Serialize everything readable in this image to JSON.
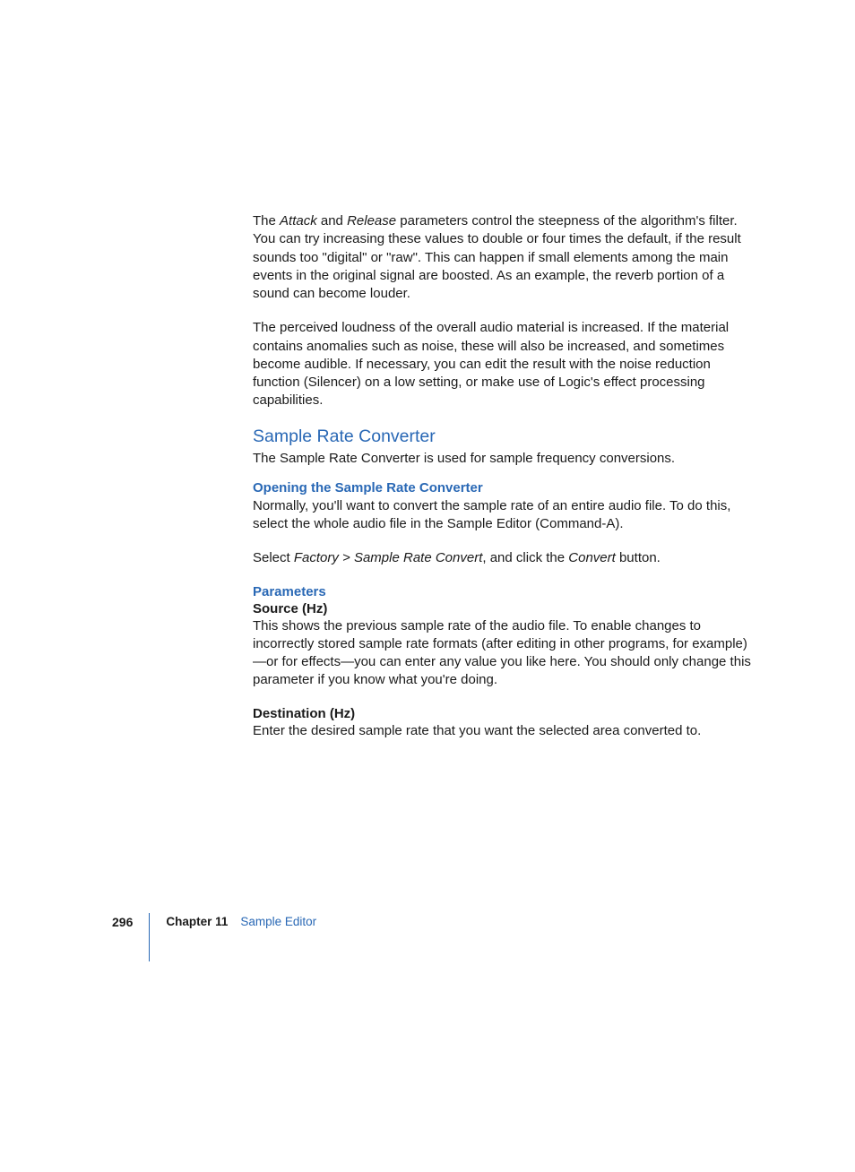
{
  "body": {
    "para1_pre": "The ",
    "para1_attack": "Attack",
    "para1_mid1": " and ",
    "para1_release": "Release",
    "para1_post": " parameters control the steepness of the algorithm's filter. You can try increasing these values to double or four times the default, if the result sounds too \"digital\" or \"raw\". This can happen if small elements among the main events in the original signal are boosted. As an example, the reverb portion of a sound can become louder.",
    "para2": "The perceived loudness of the overall audio material is increased. If the material contains anomalies such as noise, these will also be increased, and sometimes become audible. If necessary, you can edit the result with the noise reduction function (Silencer) on a low setting, or make use of Logic's effect processing capabilities.",
    "heading1": "Sample Rate Converter",
    "para3": "The Sample Rate Converter is used for sample frequency conversions.",
    "subheading1": "Opening the Sample Rate Converter",
    "para4": "Normally, you'll want to convert the sample rate of an entire audio file. To do this, select the whole audio file in the Sample Editor (Command-A).",
    "para5_pre": "Select ",
    "para5_factory": "Factory > Sample Rate Convert",
    "para5_mid": ", and click the ",
    "para5_convert": "Convert",
    "para5_post": " button.",
    "subheading2": "Parameters",
    "bold1": "Source (Hz)",
    "para6": "This shows the previous sample rate of the audio file. To enable changes to incorrectly stored sample rate formats (after editing in other programs, for example)—or for effects—you can enter any value you like here. You should only change this parameter if you know what you're doing.",
    "bold2": "Destination (Hz)",
    "para7": "Enter the desired sample rate that you want the selected area converted to."
  },
  "footer": {
    "page": "296",
    "chapter_label": "Chapter 11",
    "chapter_name": "Sample Editor"
  }
}
